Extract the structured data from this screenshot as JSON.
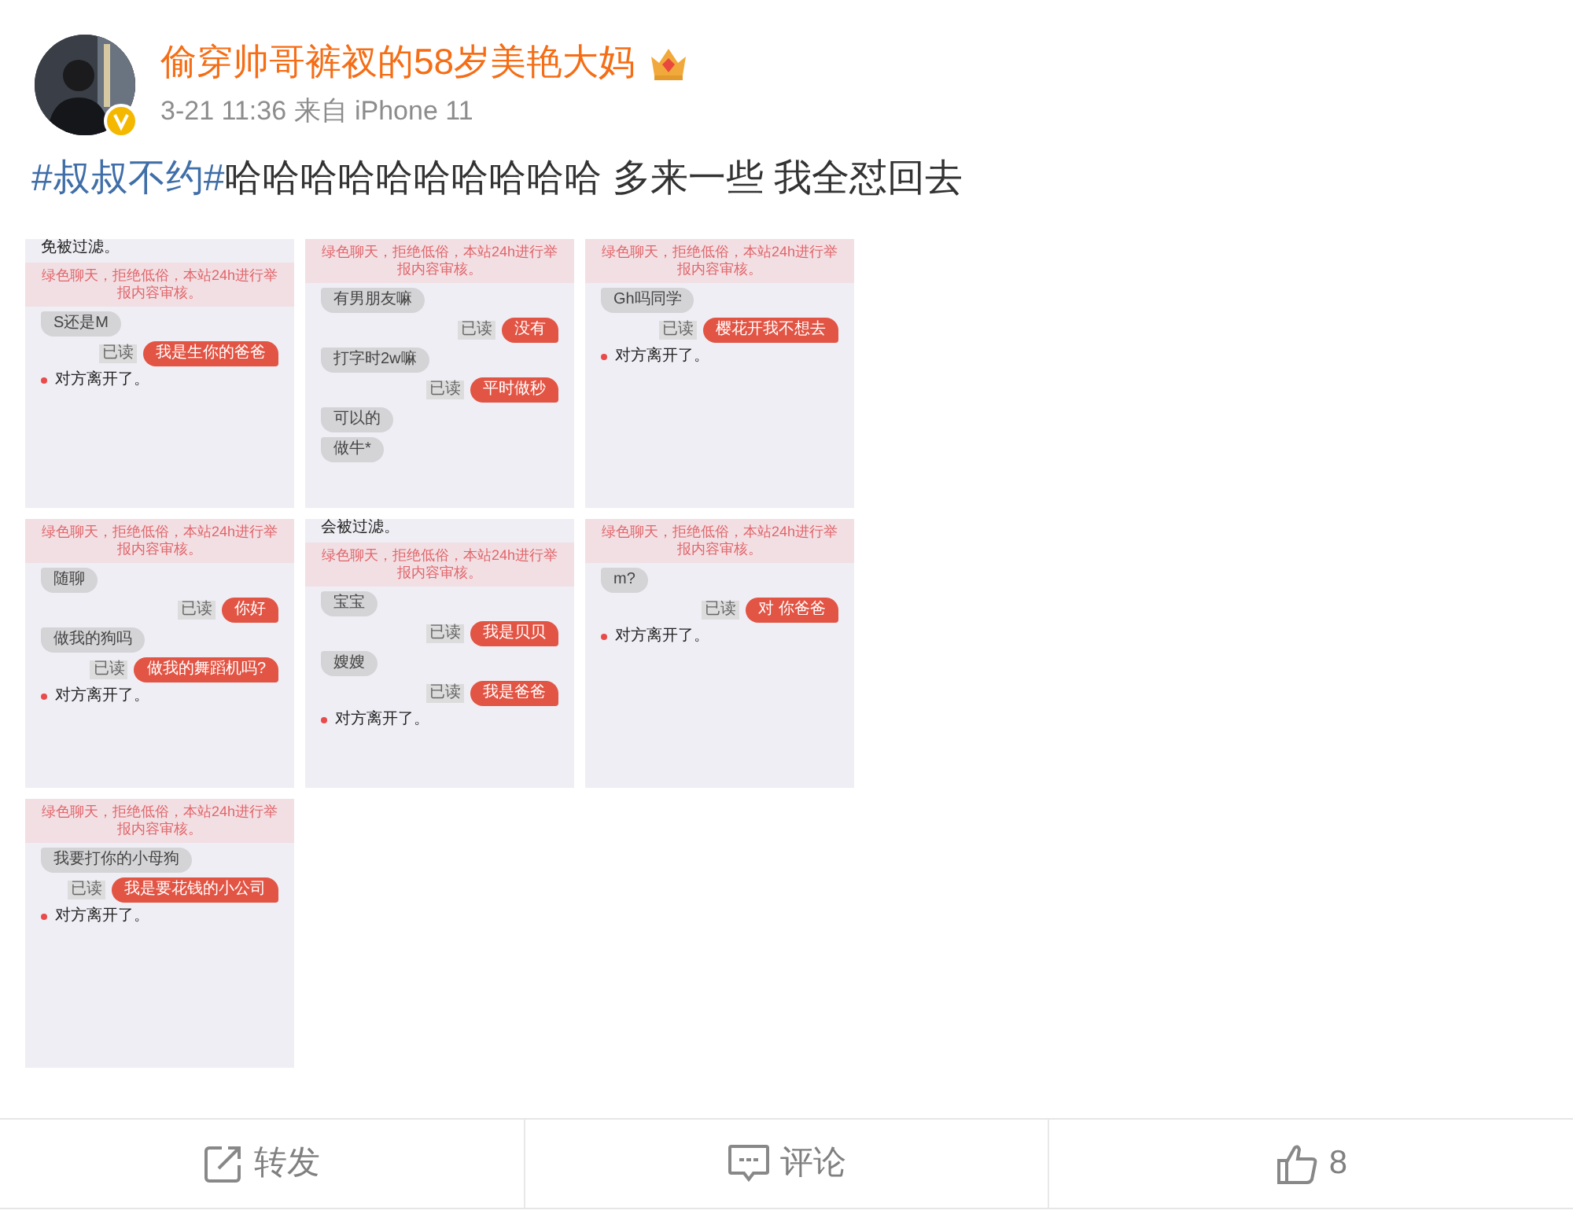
{
  "post": {
    "author": "偷穿帅哥裤衩的58岁美艳大妈",
    "meta": "3-21 11:36 来自 iPhone 11",
    "hashtag": "#叔叔不约#",
    "text": "哈哈哈哈哈哈哈哈哈哈 多来一些 我全怼回去"
  },
  "images": [
    {
      "messages": [
        {
          "kind": "note",
          "text": "免被过滤。"
        },
        {
          "kind": "banner",
          "text": "绿色聊天，拒绝低俗，本站24h进行举报内容审核。"
        },
        {
          "kind": "received",
          "text": "S还是M"
        },
        {
          "kind": "sent",
          "text": "我是生你的爸爸",
          "tag": "已读"
        },
        {
          "kind": "system",
          "text": "对方离开了。"
        }
      ]
    },
    {
      "messages": [
        {
          "kind": "banner",
          "text": "绿色聊天，拒绝低俗，本站24h进行举报内容审核。"
        },
        {
          "kind": "received",
          "text": "有男朋友嘛"
        },
        {
          "kind": "sent",
          "text": "没有",
          "tag": "已读"
        },
        {
          "kind": "received",
          "text": "打字时2w嘛"
        },
        {
          "kind": "sent",
          "text": "平时做秒",
          "tag": "已读"
        },
        {
          "kind": "received",
          "text": "可以的"
        },
        {
          "kind": "received",
          "text": "做牛*"
        }
      ]
    },
    {
      "messages": [
        {
          "kind": "banner",
          "text": "绿色聊天，拒绝低俗，本站24h进行举报内容审核。"
        },
        {
          "kind": "received",
          "text": "Gh吗同学"
        },
        {
          "kind": "sent",
          "text": "樱花开我不想去",
          "tag": "已读"
        },
        {
          "kind": "system",
          "text": "对方离开了。"
        }
      ]
    },
    {
      "messages": [
        {
          "kind": "banner",
          "text": "绿色聊天，拒绝低俗，本站24h进行举报内容审核。"
        },
        {
          "kind": "received",
          "text": "随聊"
        },
        {
          "kind": "sent",
          "text": "你好",
          "tag": "已读"
        },
        {
          "kind": "received",
          "text": "做我的狗吗"
        },
        {
          "kind": "sent",
          "text": "做我的舞蹈机吗?",
          "tag": "已读"
        },
        {
          "kind": "system",
          "text": "对方离开了。"
        }
      ]
    },
    {
      "messages": [
        {
          "kind": "note",
          "text": "会被过滤。"
        },
        {
          "kind": "banner",
          "text": "绿色聊天，拒绝低俗，本站24h进行举报内容审核。"
        },
        {
          "kind": "received",
          "text": "宝宝"
        },
        {
          "kind": "sent",
          "text": "我是贝贝",
          "tag": "已读"
        },
        {
          "kind": "received",
          "text": "嫂嫂"
        },
        {
          "kind": "sent",
          "text": "我是爸爸",
          "tag": "已读"
        },
        {
          "kind": "system",
          "text": "对方离开了。"
        }
      ]
    },
    {
      "messages": [
        {
          "kind": "banner",
          "text": "绿色聊天，拒绝低俗，本站24h进行举报内容审核。"
        },
        {
          "kind": "received",
          "text": "m?"
        },
        {
          "kind": "sent",
          "text": "对 你爸爸",
          "tag": "已读"
        },
        {
          "kind": "system",
          "text": "对方离开了。"
        }
      ]
    },
    {
      "messages": [
        {
          "kind": "banner",
          "text": "绿色聊天，拒绝低俗，本站24h进行举报内容审核。"
        },
        {
          "kind": "received",
          "text": "我要打你的小母狗"
        },
        {
          "kind": "sent",
          "text": "我是要花钱的小公司",
          "tag": "已读"
        },
        {
          "kind": "system",
          "text": "对方离开了。"
        }
      ]
    }
  ],
  "actions": [
    {
      "kind": "repost",
      "label": "转发"
    },
    {
      "kind": "comment",
      "label": "评论"
    },
    {
      "kind": "like",
      "label": "8"
    }
  ]
}
